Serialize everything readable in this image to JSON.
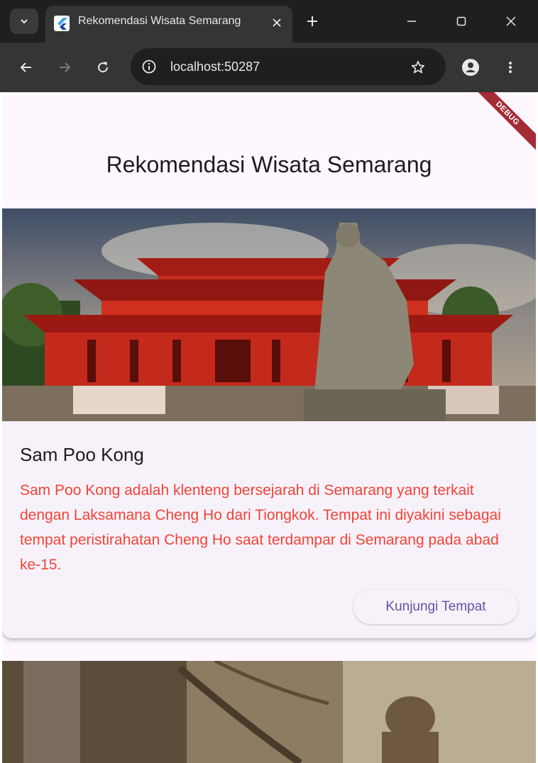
{
  "browser": {
    "tab_title": "Rekomendasi Wisata Semarang",
    "url": "localhost:50287"
  },
  "app": {
    "title": "Rekomendasi Wisata Semarang",
    "debug_label": "DEBUG"
  },
  "cards": [
    {
      "title": "Sam Poo Kong",
      "description": "Sam Poo Kong adalah klenteng bersejarah di Semarang yang terkait dengan Laksamana Cheng Ho dari Tiongkok. Tempat ini diyakini sebagai tempat peristirahatan Cheng Ho saat terdampar di Semarang pada abad ke-15.",
      "button_label": "Kunjungi Tempat"
    }
  ],
  "colors": {
    "description_text": "#f44336",
    "button_text": "#6750a4",
    "page_background": "#fef7ff",
    "card_background": "#f7f2fa",
    "debug_banner": "#a52b37"
  },
  "icons": {
    "tab_dropdown": "chevron-down-icon",
    "favicon": "flutter-icon",
    "tab_close": "close-icon",
    "new_tab": "plus-icon",
    "minimize": "minimize-icon",
    "maximize": "maximize-icon",
    "window_close": "close-icon",
    "back": "arrow-left-icon",
    "forward": "arrow-right-icon",
    "reload": "reload-icon",
    "site_info": "info-icon",
    "bookmark": "star-icon",
    "profile": "person-icon",
    "menu": "more-vert-icon"
  }
}
